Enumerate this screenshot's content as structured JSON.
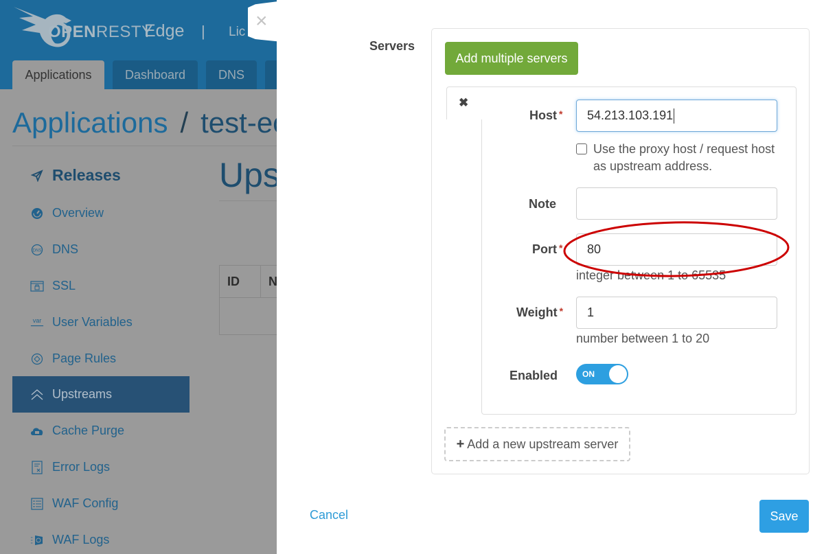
{
  "header": {
    "logo_bold": "OPEN",
    "logo_rest": "RESTY",
    "product": "Edge",
    "separator": "|",
    "license_partial": "Lic",
    "tabs": [
      {
        "label": "Applications",
        "active": true
      },
      {
        "label": "Dashboard",
        "active": false
      },
      {
        "label": "DNS",
        "active": false
      }
    ]
  },
  "breadcrumb": {
    "root": "Applications",
    "separator": "/",
    "current_partial": "test-ec"
  },
  "sidebar": {
    "items": [
      {
        "label": "Releases",
        "icon": "paper-plane-icon",
        "heading": true
      },
      {
        "label": "Overview",
        "icon": "dashboard-gauge-icon"
      },
      {
        "label": "DNS",
        "icon": "dns-globe-icon"
      },
      {
        "label": "SSL",
        "icon": "ssl-lock-icon"
      },
      {
        "label": "User Variables",
        "icon": "var-icon"
      },
      {
        "label": "Page Rules",
        "icon": "page-rules-icon"
      },
      {
        "label": "Upstreams",
        "icon": "upstreams-chevron-icon",
        "active": true
      },
      {
        "label": "Cache Purge",
        "icon": "cloud-icon"
      },
      {
        "label": "Error Logs",
        "icon": "error-log-icon"
      },
      {
        "label": "WAF Config",
        "icon": "list-icon"
      },
      {
        "label": "WAF Logs",
        "icon": "waf-logs-icon"
      }
    ]
  },
  "page": {
    "title_partial": "Ups",
    "table_headers": [
      "ID",
      "N"
    ]
  },
  "modal": {
    "close_icon": "×",
    "servers_label": "Servers",
    "add_multiple_label": "Add multiple servers",
    "remove_icon": "✖",
    "server": {
      "host_label": "Host",
      "host_value": "54.213.103.191",
      "use_proxy_host_label": "Use the proxy host / request host as upstream address.",
      "use_proxy_host_checked": false,
      "note_label": "Note",
      "note_value": "",
      "port_label": "Port",
      "port_value": "80",
      "port_help": "integer between 1 to 65535",
      "weight_label": "Weight",
      "weight_value": "1",
      "weight_help": "number between 1 to 20",
      "enabled_label": "Enabled",
      "enabled_state": "ON",
      "required_mark": "*"
    },
    "add_server_plus": "+",
    "add_server_label": "Add a new upstream server",
    "cancel_label": "Cancel",
    "save_label": "Save"
  },
  "annotation": {
    "color": "#cc0000",
    "target": "port-field"
  }
}
